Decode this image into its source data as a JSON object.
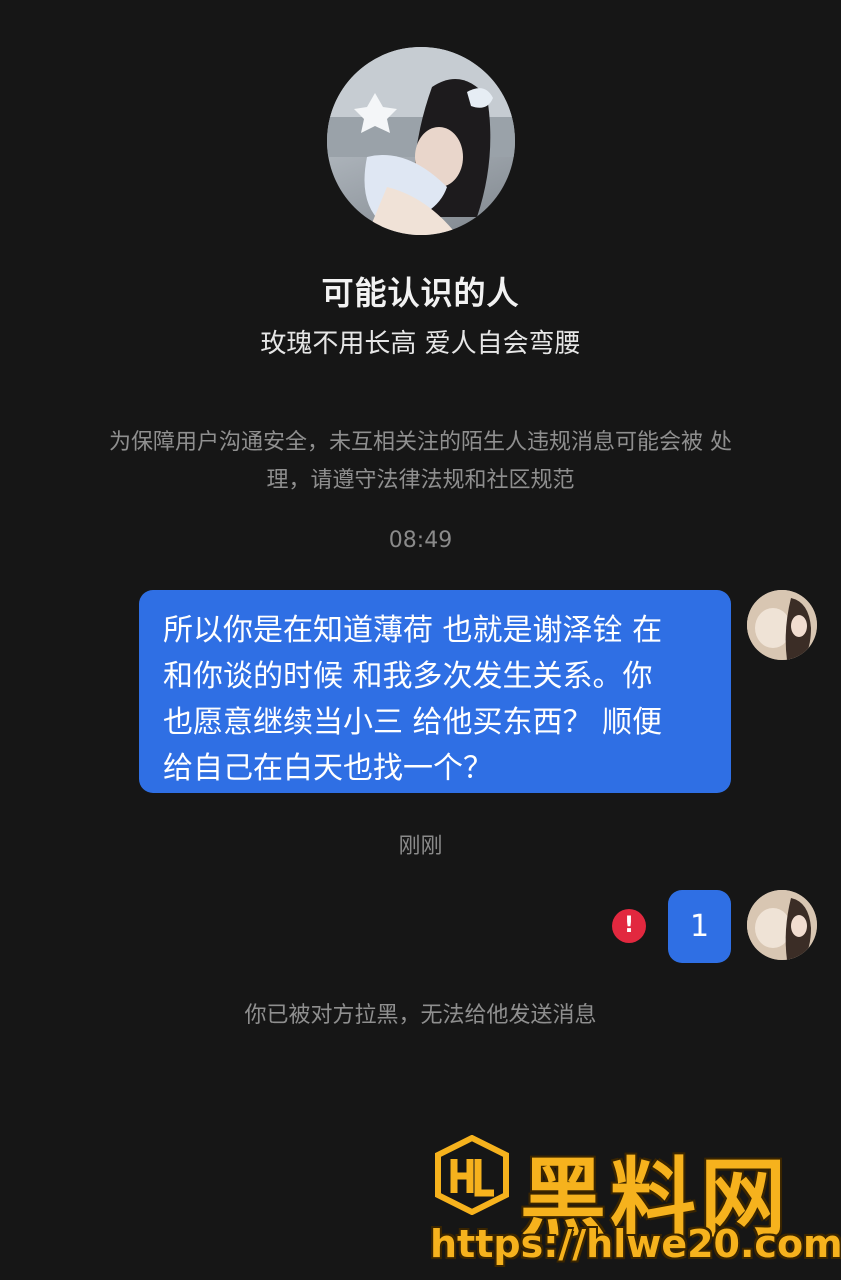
{
  "profile": {
    "name": "可能认识的人",
    "bio": "玫瑰不用长高 爱人自会弯腰"
  },
  "notice": "为保障用户沟通安全，未互相关注的陌生人违规消息可能会被\n处理，请遵守法律法规和社区规范",
  "messages": [
    {
      "time": "08:49",
      "text": "所以你是在知道薄荷 也就是谢泽铨 在\n和你谈的时候 和我多次发生关系。你\n也愿意继续当小三 给他买东西？ 顺便\n给自己在白天也找一个？"
    },
    {
      "time": "刚刚",
      "text": "1",
      "failed": true
    }
  ],
  "blocked_notice": "你已被对方拉黑，无法给他发送消息",
  "watermark": {
    "title": "黑料网",
    "url": "https://hlwe20.com",
    "logo_icon": "hl-shield-logo-icon"
  },
  "colors": {
    "background": "#161616",
    "bubble": "#2f6fe4",
    "error": "#e2283f",
    "watermark": "#f6b21d"
  }
}
